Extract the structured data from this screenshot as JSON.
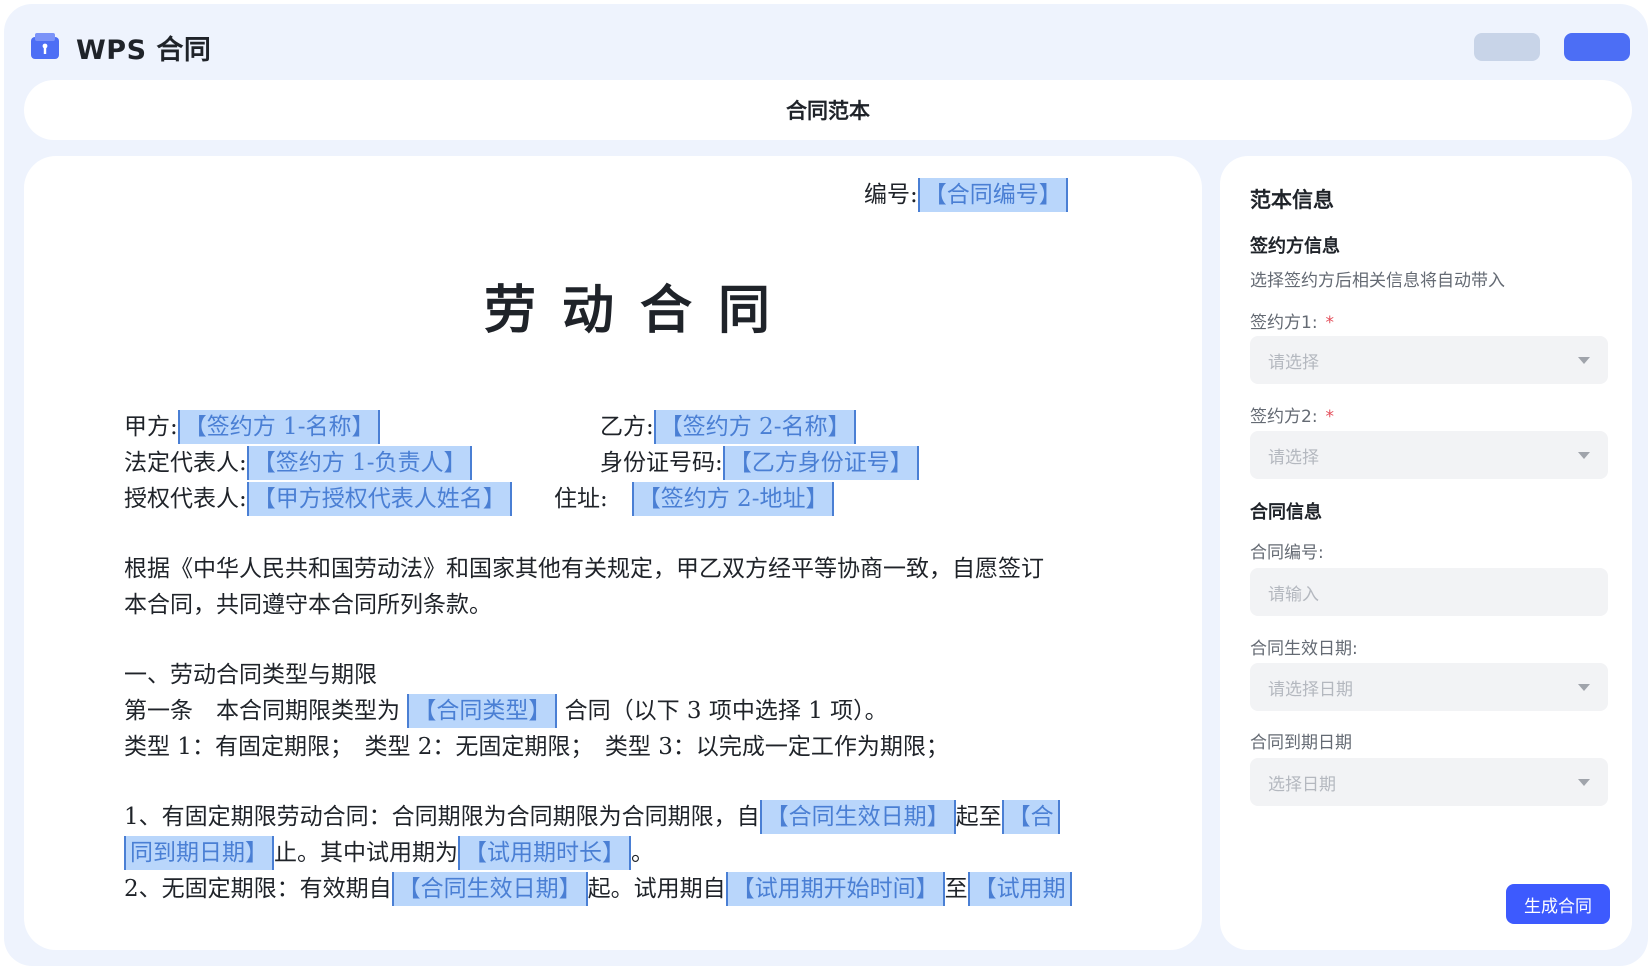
{
  "app": {
    "title": "WPS 合同"
  },
  "tab": {
    "title": "合同范本"
  },
  "doc": {
    "number_label": "编号:",
    "number_field": "【合同编号】",
    "title": "劳动合同",
    "party_a_label": "甲方:",
    "party_a_field": "【签约方 1-名称】",
    "party_b_label": "乙方:",
    "party_b_field": "【签约方 2-名称】",
    "legal_rep_label": "法定代表人:",
    "legal_rep_field": "【签约方 1-负责人】",
    "id_label": "身份证号码:",
    "id_field": "【乙方身份证号】",
    "auth_rep_label": "授权代表人:",
    "auth_rep_field": "【甲方授权代表人姓名】",
    "address_label": "住址:",
    "address_field": "【签约方 2-地址】",
    "para1_line1": "根据《中华人民共和国劳动法》和国家其他有关规定，甲乙双方经平等协商一致，自愿签订",
    "para1_line2": "本合同，共同遵守本合同所列条款。",
    "section1": "一、劳动合同类型与期限",
    "art1_prefix": "第一条　本合同期限类型为",
    "art1_field": "【合同类型】",
    "art1_suffix": "合同（以下 3 项中选择 1 项）。",
    "types_line": "类型 1：有固定期限；　类型 2：无固定期限；　类型 3：以完成一定工作为期限；",
    "item1_prefix": "1、有固定期限劳动合同：合同期限为合同期限为合同期限，自",
    "item1_field1": "【合同生效日期】",
    "item1_mid": "起至",
    "item1_field2a": "【合",
    "item1_field2b": "同到期日期】",
    "item1_end": "止。其中试用期为",
    "item1_field3": "【试用期时长】",
    "item1_period": "。",
    "item2_prefix": "2、无固定期限：有效期自",
    "item2_field1": "【合同生效日期】",
    "item2_mid": "起。试用期自",
    "item2_field2": "【试用期开始时间】",
    "item2_to": "至",
    "item2_field3": "【试用期"
  },
  "side": {
    "title": "范本信息",
    "signer_section": "签约方信息",
    "signer_hint": "选择签约方后相关信息将自动带入",
    "signer1_label": "签约方1:",
    "signer1_placeholder": "请选择",
    "signer2_label": "签约方2:",
    "signer2_placeholder": "请选择",
    "required_mark": "*",
    "contract_section": "合同信息",
    "number_label": "合同编号:",
    "number_placeholder": "请输入",
    "effective_label": "合同生效日期:",
    "effective_placeholder": "请选择日期",
    "expiry_label": "合同到期日期",
    "expiry_placeholder": "选择日期",
    "generate_button": "生成合同"
  },
  "colors": {
    "accent": "#3d5afe",
    "field_bg": "#b9d6fb",
    "field_text": "#4a7fd4",
    "app_bg": "#eef3fd"
  }
}
